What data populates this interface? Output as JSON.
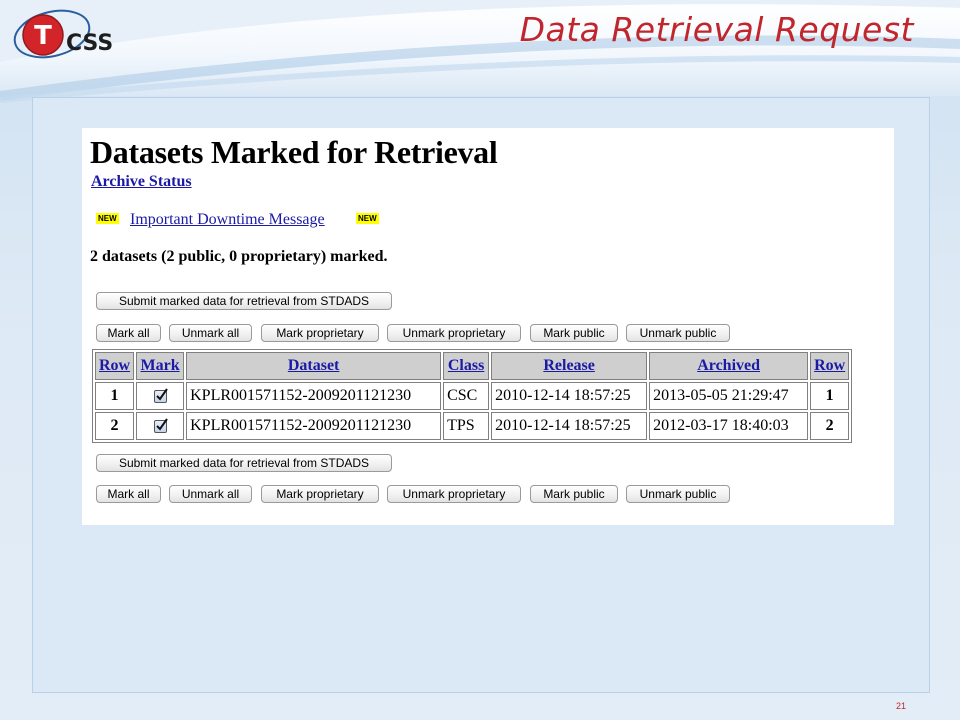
{
  "slide": {
    "title": "Data Retrieval Request",
    "logo_text": "CSS",
    "logo_letter": "T",
    "page_number": "21"
  },
  "panel": {
    "title": "Datasets Marked for Retrieval",
    "archive_status_link": "Archive Status",
    "new_badge": "NEW",
    "downtime_link": "Important Downtime Message",
    "summary": "2 datasets (2 public, 0 proprietary) marked.",
    "submit_label": "Submit marked data for retrieval from STDADS",
    "mark_buttons": {
      "mark_all": "Mark all",
      "unmark_all": "Unmark all",
      "mark_proprietary": "Mark proprietary",
      "unmark_proprietary": "Unmark proprietary",
      "mark_public": "Mark public",
      "unmark_public": "Unmark public"
    }
  },
  "table": {
    "columns": [
      "Row",
      "Mark",
      "Dataset",
      "Class",
      "Release",
      "Archived",
      "Row"
    ],
    "rows": [
      {
        "row": "1",
        "marked": true,
        "dataset": "KPLR001571152-2009201121230",
        "class": "CSC",
        "release": "2010-12-14 18:57:25",
        "archived": "2013-05-05 21:29:47",
        "row_end": "1"
      },
      {
        "row": "2",
        "marked": true,
        "dataset": "KPLR001571152-2009201121230",
        "class": "TPS",
        "release": "2010-12-14 18:57:25",
        "archived": "2012-03-17 18:40:03",
        "row_end": "2"
      }
    ]
  },
  "colors": {
    "title_red": "#c0262c",
    "link_blue": "#1a1aa6",
    "badge_yellow": "#ffff00",
    "header_gray": "#cfcfcf"
  },
  "icons": {
    "logo": "tcss-logo",
    "checkbox": "checked-checkbox-icon"
  }
}
